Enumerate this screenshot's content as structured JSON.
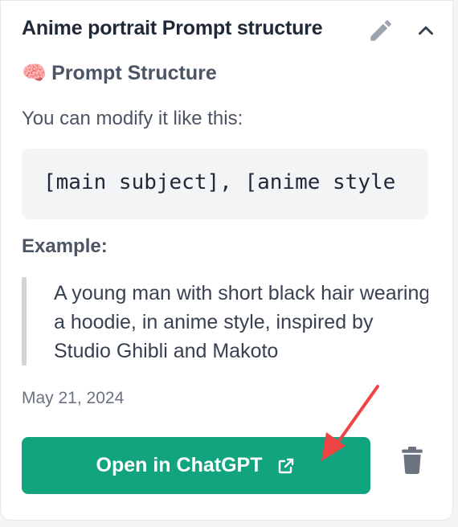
{
  "card": {
    "title": "Anime portrait Prompt structure",
    "edit_icon": "pencil-icon",
    "collapse_icon": "chevron-up-icon"
  },
  "content": {
    "section_emoji": "🧠",
    "section_heading": "Prompt Structure",
    "intro_text": "You can modify it like this:",
    "code_text": "[main subject], [anime style",
    "example_label": "Example:",
    "example_quote": "A young man with short black hair wearing a hoodie, in anime style, inspired by Studio Ghibli and Makoto"
  },
  "footer": {
    "date": "May 21, 2024",
    "open_button_label": "Open in ChatGPT",
    "open_button_icon": "external-link-icon",
    "delete_icon": "trash-icon"
  },
  "colors": {
    "accent": "#12a37f",
    "annotation_arrow": "#ef4444"
  }
}
